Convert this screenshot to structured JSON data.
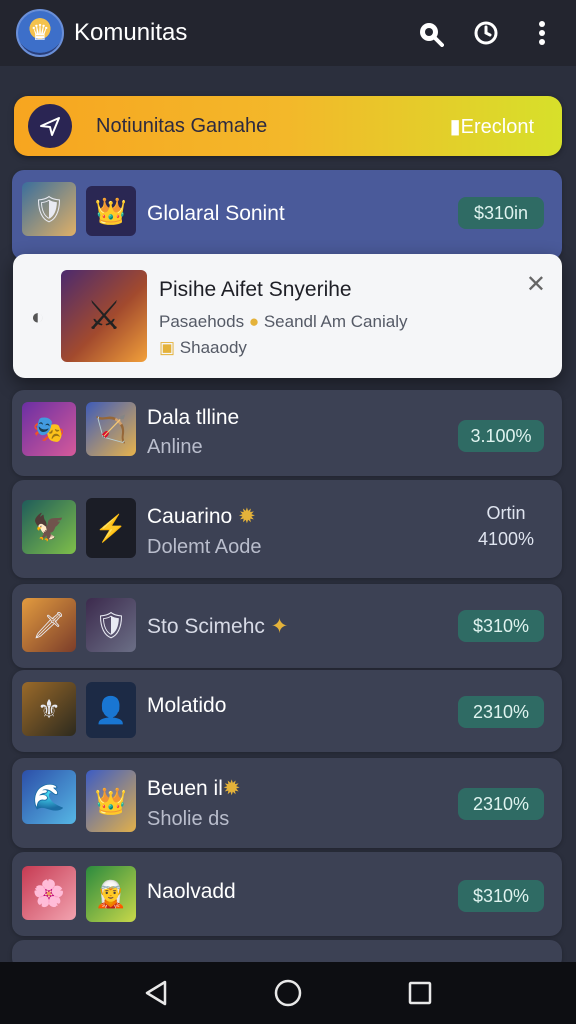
{
  "app": {
    "title": "Komunitas",
    "colors": {
      "topbar": "#23252f",
      "background": "#2b2f3d",
      "accent": "#2f6b64"
    }
  },
  "banner": {
    "title": "Notiunitas Gamahe",
    "action": "Ereclont",
    "icon": "send-icon"
  },
  "popup": {
    "title": "Pisihe Aifet Snyerihe",
    "line1": "Pasaehods",
    "line1_rest": "Seandl Am Canialy",
    "line2": "Shaaody",
    "close_icon": "close-icon"
  },
  "list": [
    {
      "name": "Glolaral Sonint",
      "status": "",
      "value": "$310in",
      "highlight": true
    },
    {
      "name": "Dala tlline",
      "status": "Anline",
      "value": "3.100%"
    },
    {
      "name": "Cauarino",
      "status": "Dolemt Aode",
      "value_top": "Ortin",
      "value": "4100%"
    },
    {
      "name": "Sto Scimehc",
      "status": "",
      "value": "$310%"
    },
    {
      "name": "Molatido",
      "status": "",
      "value": "2310%"
    },
    {
      "name": "Beuen il",
      "status": "Sholie ds",
      "value": "2310%"
    },
    {
      "name": "Naolvadd",
      "status": "",
      "value": "$310%"
    }
  ]
}
